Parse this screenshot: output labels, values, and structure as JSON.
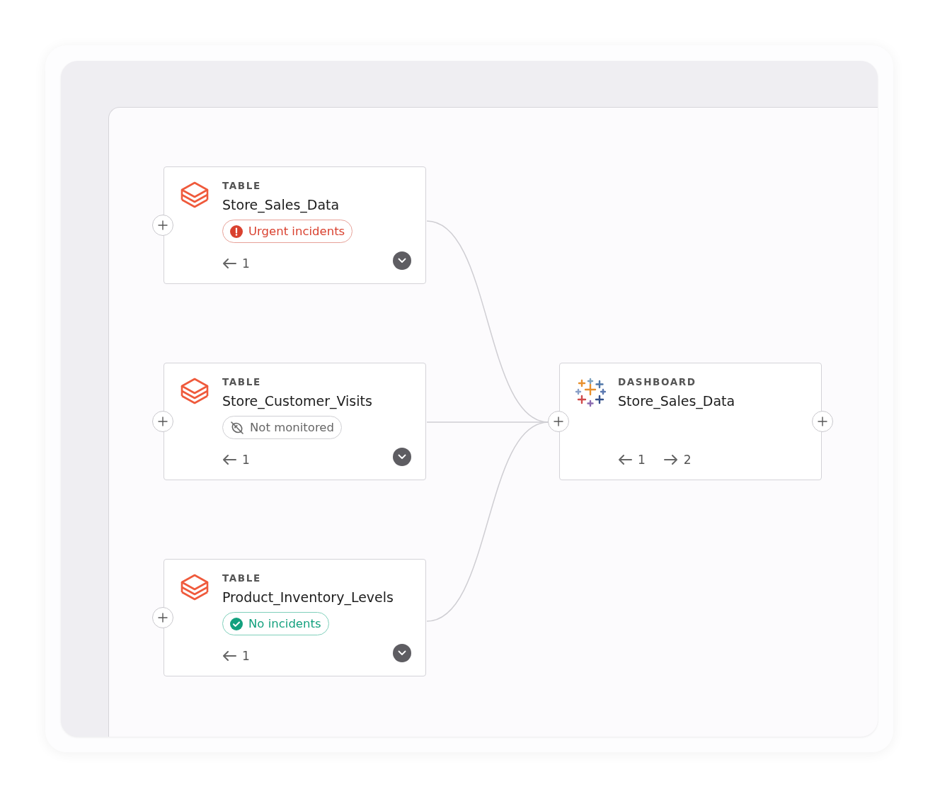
{
  "nodes": [
    {
      "kind": "table",
      "type": "TABLE",
      "name": "Store_Sales_Data",
      "status": {
        "kind": "urgent",
        "label": "Urgent incidents"
      },
      "upstream": "1"
    },
    {
      "kind": "table",
      "type": "TABLE",
      "name": "Store_Customer_Visits",
      "status": {
        "kind": "unmonitored",
        "label": "Not monitored"
      },
      "upstream": "1"
    },
    {
      "kind": "table",
      "type": "TABLE",
      "name": "Product_Inventory_Levels",
      "status": {
        "kind": "ok",
        "label": "No incidents"
      },
      "upstream": "1"
    },
    {
      "kind": "dashboard",
      "type": "DASHBOARD",
      "name": "Store_Sales_Data",
      "upstream": "1",
      "downstream": "2"
    }
  ]
}
